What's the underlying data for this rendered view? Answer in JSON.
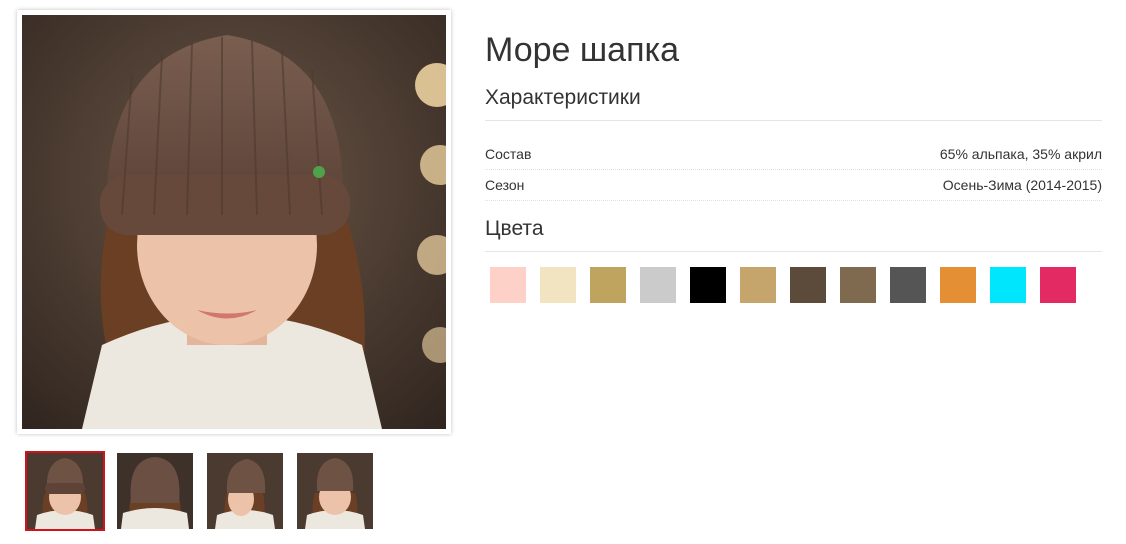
{
  "product": {
    "title": "Море шапка",
    "characteristics_title": "Характеристики",
    "specs": [
      {
        "label": "Состав",
        "value": "65% альпака, 35% акрил"
      },
      {
        "label": "Сезон",
        "value": "Осень-Зима (2014-2015)"
      }
    ],
    "colors_title": "Цвета",
    "colors": [
      "#fdd0c8",
      "#f2e4c0",
      "#bea45e",
      "#cbcbcb",
      "#000000",
      "#c6a56d",
      "#5c4a3a",
      "#7f6a50",
      "#555555",
      "#e58f35",
      "#00e6fd",
      "#e42a63",
      "#ffffff"
    ]
  },
  "gallery": {
    "main_image": "woman-in-brown-knit-beanie-photo",
    "thumbnails": [
      "front-view-thumbnail",
      "back-view-thumbnail",
      "side-view-thumbnail",
      "front-alt-view-thumbnail"
    ],
    "active_index": 0
  }
}
